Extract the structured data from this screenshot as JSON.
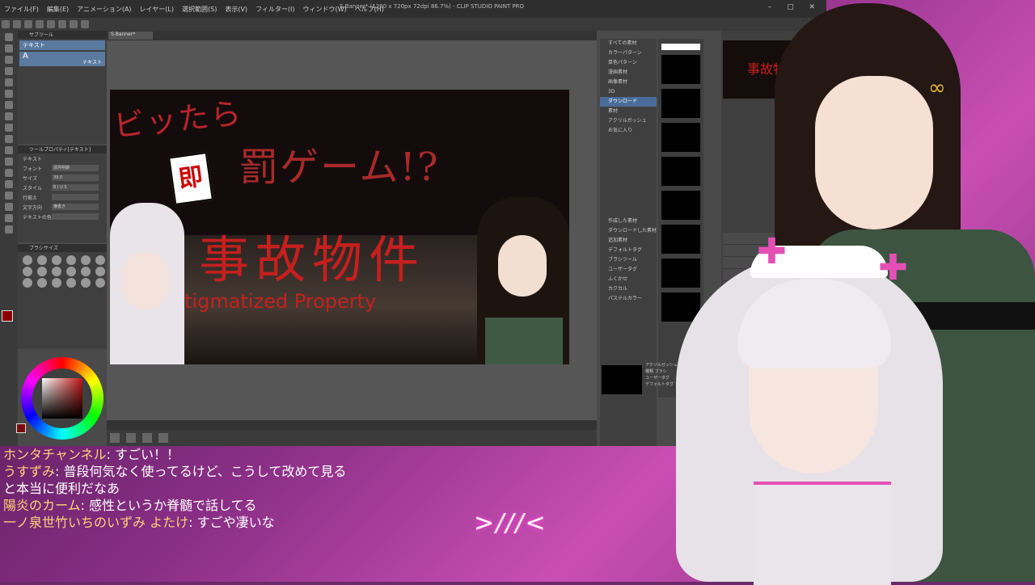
{
  "app": {
    "title": "S.Banner* (1280 x 720px 72dpi 86.7%) - CLIP STUDIO PAINT PRO",
    "menu": [
      "ファイル(F)",
      "編集(E)",
      "アニメーション(A)",
      "レイヤー(L)",
      "選択範囲(S)",
      "表示(V)",
      "フィルター(I)",
      "ウィンドウ(W)",
      "ヘルプ(H)"
    ],
    "canvas_tab": "S.Banner*",
    "subtool": {
      "header": "サブツール",
      "item1": "テキスト",
      "item2": "A",
      "item2_label": "テキスト"
    },
    "toolprop": {
      "header": "ツールプロパティ[テキスト]",
      "title": "テキスト",
      "rows": [
        {
          "label": "フォント",
          "value": "源界明朝"
        },
        {
          "label": "サイズ",
          "value": "39.0"
        },
        {
          "label": "スタイル",
          "value": "B I U S"
        },
        {
          "label": "行揃え",
          "value": ""
        },
        {
          "label": "文字方向",
          "value": "横書き"
        },
        {
          "label": "テキストの色",
          "value": ""
        }
      ]
    },
    "brushsize_header": "ブラシサイズ",
    "material_tree": [
      "すべての素材",
      "カラーパターン",
      "単色パターン",
      "漫画素材",
      "画像素材",
      "3D",
      "ダウンロード",
      "素材",
      "アクリルガッシュ",
      "お気に入り"
    ],
    "material_tree_selected": 6,
    "material_info": [
      "アクリルガッシュ4",
      "種類 ブラシ",
      "ユーザータグ",
      "デフォルトタグ ブラシ"
    ],
    "search_tags": [
      "作成した素材",
      "ダウンロードした素材",
      "追加素材",
      "デフォルトタグ",
      "ブラシツール",
      "ユーザータグ",
      "ふくかせ",
      "カクカル",
      "パステルカラー"
    ]
  },
  "artwork": {
    "line1": "ビッたら",
    "badge": "即",
    "line2": "罰ゲーム!?",
    "line3": "事故物件",
    "line4": "tigmatized Property"
  },
  "chat": [
    {
      "name": "ホンタチャンネル",
      "text": "すごい！！"
    },
    {
      "name": "うすずみ",
      "text": "普段何気なく使ってるけど、こうして改めて見ると本当に便利だなあ"
    },
    {
      "name": "陽炎のカーム",
      "text": "感性というか脊髄で話してる"
    },
    {
      "name": "一ノ泉世竹いちのいずみ よたけ",
      "text": "すごや凄いな"
    }
  ],
  "emote": ">///<",
  "colors": {
    "accent_pink": "#e54fb5",
    "title_red": "#c4201e",
    "chat_name": "#ffd27a"
  }
}
